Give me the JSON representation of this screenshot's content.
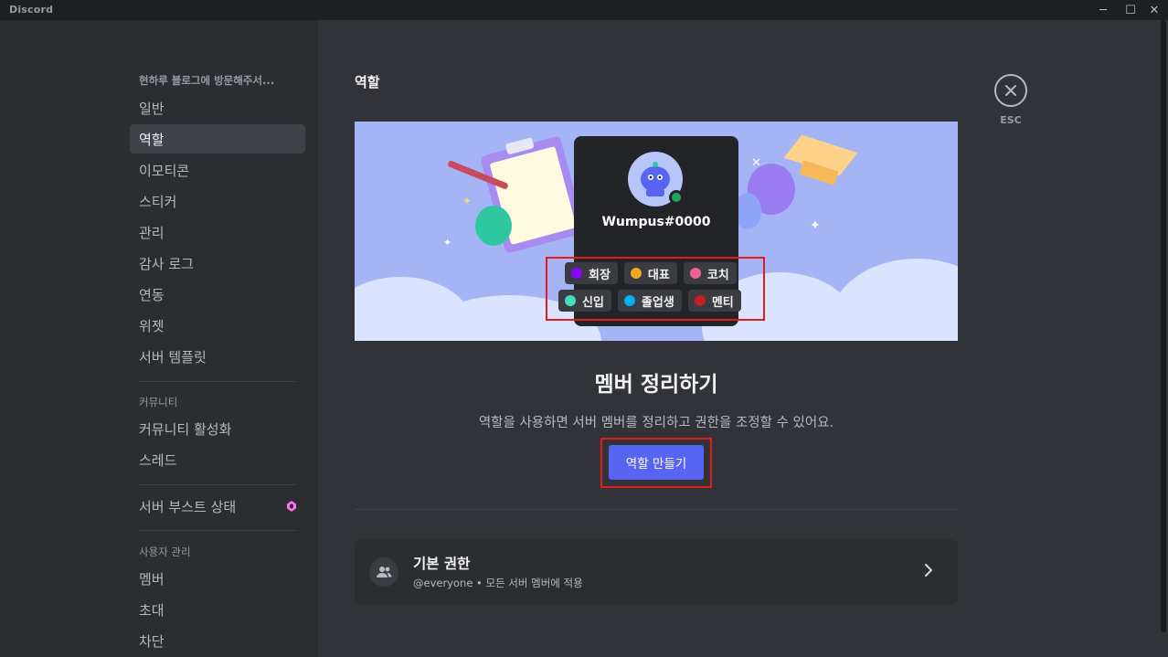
{
  "app": {
    "title": "Discord",
    "window_controls": {
      "minimize": "─",
      "maximize": "☐",
      "close": "✕"
    }
  },
  "sidebar": {
    "server_header": "현하루 블로그에 방문해주서...",
    "items": [
      {
        "label": "일반",
        "active": false
      },
      {
        "label": "역할",
        "active": true
      },
      {
        "label": "이모티콘",
        "active": false
      },
      {
        "label": "스티커",
        "active": false
      },
      {
        "label": "관리",
        "active": false
      },
      {
        "label": "감사 로그",
        "active": false
      },
      {
        "label": "연동",
        "active": false
      },
      {
        "label": "위젯",
        "active": false
      },
      {
        "label": "서버 템플릿",
        "active": false
      }
    ],
    "community_header": "커뮤니티",
    "community_items": [
      {
        "label": "커뮤니티 활성화"
      },
      {
        "label": "스레드"
      }
    ],
    "boost_item": {
      "label": "서버 부스트 상태",
      "icon": "boost-gem-icon"
    },
    "user_mgmt_header": "사용자 관리",
    "user_mgmt_items": [
      {
        "label": "멤버"
      },
      {
        "label": "초대"
      },
      {
        "label": "차단"
      }
    ]
  },
  "main": {
    "title": "역할",
    "banner": {
      "username": "Wumpus#0000",
      "roles_row1": [
        {
          "name": "회장",
          "color": "#8b00ff"
        },
        {
          "name": "대표",
          "color": "#f5a623"
        },
        {
          "name": "코치",
          "color": "#f06292"
        }
      ],
      "roles_row2": [
        {
          "name": "신입",
          "color": "#45ddc0"
        },
        {
          "name": "졸업생",
          "color": "#00b0f4"
        },
        {
          "name": "멘티",
          "color": "#c51f1f"
        }
      ]
    },
    "heading": "멤버 정리하기",
    "description": "역할을 사용하면 서버 멤버를 정리하고 권한을 조정할 수 있어요.",
    "create_button": "역할 만들기",
    "default_permissions": {
      "title": "기본 권한",
      "subtitle": "@everyone • 모든 서버 멤버에 적용"
    },
    "esc_label": "ESC"
  },
  "colors": {
    "accent": "#5865f2",
    "highlight": "#e31b1b",
    "boost": "#ff73fa",
    "online": "#23a55a"
  }
}
